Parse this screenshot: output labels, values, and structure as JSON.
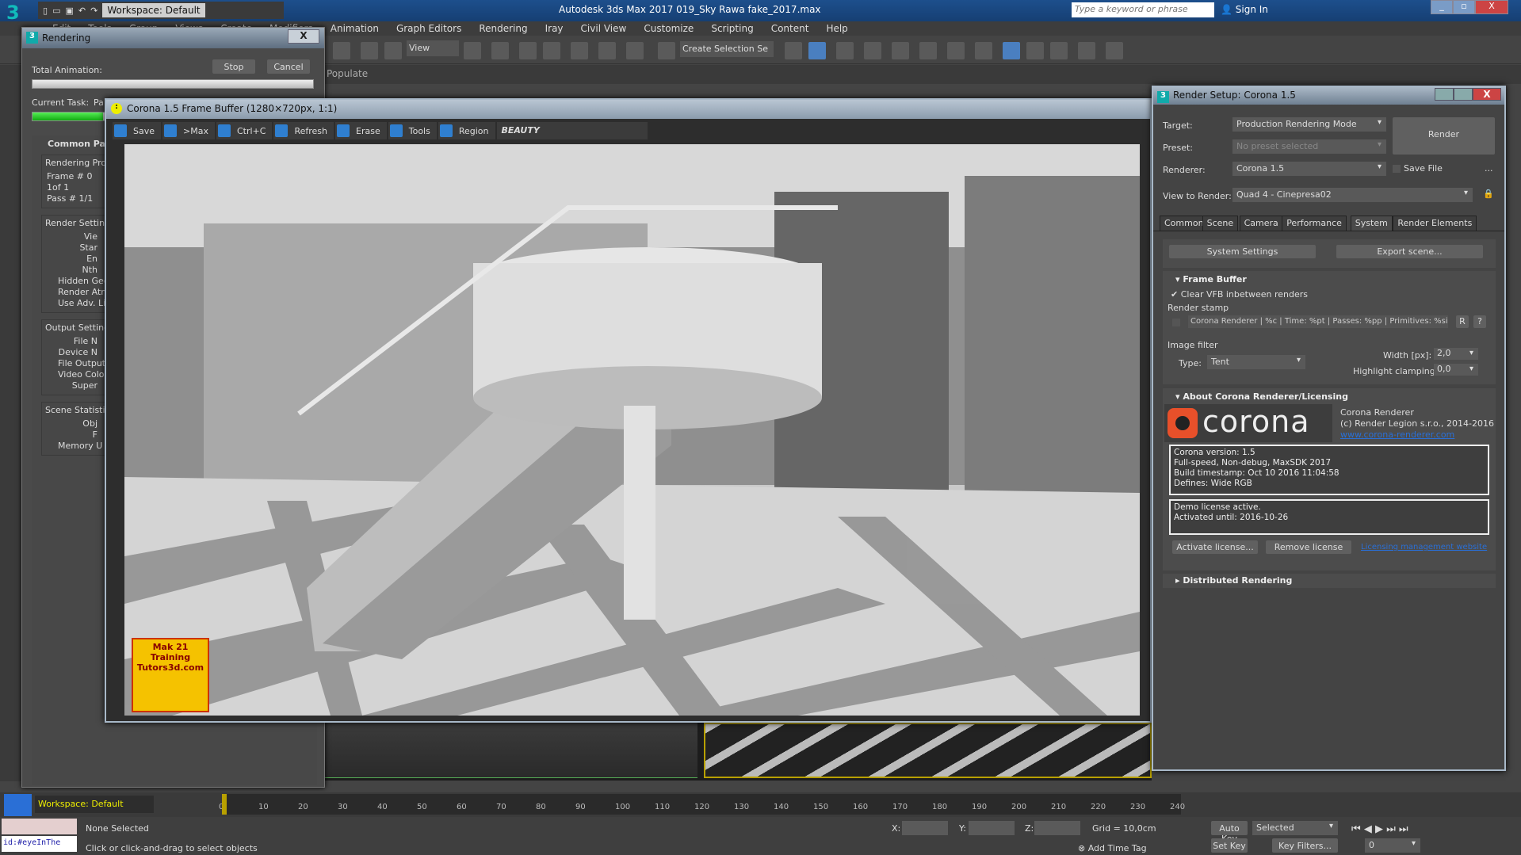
{
  "app": {
    "title": "Autodesk 3ds Max 2017    019_Sky Rawa fake_2017.max",
    "workspace": "Workspace: Default",
    "search_placeholder": "Type a keyword or phrase",
    "sign_in": "Sign In"
  },
  "menu": [
    "Edit",
    "Tools",
    "Group",
    "Views",
    "Create",
    "Modifiers",
    "Animation",
    "Graph Editors",
    "Rendering",
    "Iray",
    "Civil View",
    "Customize",
    "Scripting",
    "Content",
    "Help"
  ],
  "toolbar": {
    "view_dropdown": "View",
    "selection_set": "Create Selection Se",
    "ribbon_populate": "Populate"
  },
  "rendering_dialog": {
    "title": "Rendering",
    "total_animation": "Total Animation:",
    "stop": "Stop",
    "cancel": "Cancel",
    "current_task": "Current Task:",
    "current_task_value": "Pa",
    "total_progress": 1.0,
    "task_progress": 0.25,
    "common_params": "Common Par",
    "groups": [
      {
        "title": "Rendering Pro",
        "rows": [
          "Frame #  0",
          "1of  1",
          "Pass #  1/1"
        ]
      },
      {
        "title": "Render Setting",
        "rows": [
          "Vie",
          "Star",
          "En",
          "Nth",
          "Hidden Geo",
          "Render Atmos",
          "Use Adv. Li"
        ]
      },
      {
        "title": "Output Setting",
        "rows": [
          "File N",
          "Device N",
          "File Output Ga",
          "Video Color C",
          "Super"
        ]
      },
      {
        "title": "Scene Statistic",
        "rows": [
          "Obj",
          "F",
          "Memory U"
        ]
      }
    ]
  },
  "frame_buffer": {
    "title": "Corona 1.5 Frame Buffer (1280×720px, 1:1)",
    "buttons": [
      "Save",
      ">Max",
      "Ctrl+C",
      "Refresh",
      "Erase",
      "Tools",
      "Region"
    ],
    "channel": "BEAUTY",
    "watermark": "Mak 21 Training Tutors3d.com"
  },
  "render_setup": {
    "title": "Render Setup: Corona 1.5",
    "target_label": "Target:",
    "target": "Production Rendering Mode",
    "preset_label": "Preset:",
    "preset": "No preset selected",
    "renderer_label": "Renderer:",
    "renderer": "Corona 1.5",
    "view_label": "View to Render:",
    "view": "Quad 4 - Cinepresa02",
    "render_button": "Render",
    "save_file": "Save File",
    "more": "...",
    "tabs": [
      "Common",
      "Scene",
      "Camera",
      "Performance",
      "System",
      "Render Elements"
    ],
    "active_tab": "System",
    "system_settings": "System Settings",
    "export_scene": "Export scene...",
    "frame_buffer": {
      "title": "Frame Buffer",
      "clear_vfb": "Clear VFB inbetween renders",
      "clear_vfb_checked": true,
      "render_stamp": "Render stamp",
      "stamp_text": "Corona Renderer | %c | Time: %pt | Passes: %pp | Primitives: %si",
      "stamp_enabled": false,
      "r": "R",
      "help": "?"
    },
    "image_filter": {
      "title": "Image filter",
      "type_label": "Type:",
      "type": "Tent",
      "width_label": "Width [px]:",
      "width": "2,0",
      "clamp_label": "Highlight clamping:",
      "clamp": "0,0"
    },
    "about": {
      "title": "About Corona Renderer/Licensing",
      "logo": "corona",
      "name": "Corona Renderer",
      "copyright": "(c) Render Legion s.r.o., 2014-2016",
      "url": "www.corona-renderer.com",
      "version_lines": [
        "Corona version: 1.5",
        "Full-speed, Non-debug, MaxSDK 2017",
        "Build timestamp: Oct 10 2016 11:04:58",
        "Defines: Wide RGB"
      ],
      "license_lines": [
        "Demo license active.",
        "Activated until: 2016-10-26"
      ],
      "activate": "Activate license...",
      "remove": "Remove license",
      "licensing_link": "Licensing management website"
    },
    "distributed": "Distributed Rendering"
  },
  "timeline": {
    "ticks": [
      "0",
      "10",
      "20",
      "30",
      "40",
      "50",
      "60",
      "70",
      "80",
      "90",
      "100",
      "110",
      "120",
      "130",
      "140",
      "150",
      "160",
      "170",
      "180",
      "190",
      "200",
      "210",
      "220",
      "230",
      "240"
    ],
    "current_frame": 0
  },
  "status": {
    "workspace": "Workspace: Default",
    "selection": "None Selected",
    "prompt": "Click or click-and-drag to select objects",
    "script": "id:#eyeInThe",
    "x_label": "X:",
    "y_label": "Y:",
    "z_label": "Z:",
    "grid": "Grid = 10,0cm",
    "add_time_tag": "Add Time Tag",
    "auto_key": "Auto Key",
    "set_key": "Set Key",
    "key_mode": "Selected",
    "key_filters": "Key Filters...",
    "frame": "0"
  },
  "colors": {
    "accent": "#2f7fd0",
    "titlebar": "#1d4f8c",
    "progress": "#22bb22",
    "corona_orange": "#e8502a"
  }
}
